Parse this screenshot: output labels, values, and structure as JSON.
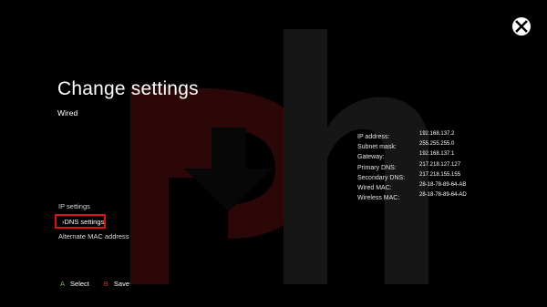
{
  "header": {
    "title": "Change settings",
    "subtitle": "Wired"
  },
  "menu": {
    "items": [
      {
        "label": "IP settings"
      },
      {
        "label": "DNS settings",
        "selected": true
      },
      {
        "label": "Alternate MAC address"
      }
    ],
    "selected_prefix": "›"
  },
  "network_info": {
    "rows": [
      {
        "label": "IP address:",
        "value": "192.168.137.2"
      },
      {
        "label": "Subnet mask:",
        "value": "255.255.255.0"
      },
      {
        "label": "Gateway:",
        "value": "192.168.137.1"
      },
      {
        "label": "Primary DNS:",
        "value": "217.218.127.127"
      },
      {
        "label": "Secondary DNS:",
        "value": "217.218.155.155"
      },
      {
        "label": "Wired MAC:",
        "value": "28-18-78-89-64-AB"
      },
      {
        "label": "Wireless MAC:",
        "value": "28-18-78-89-64-AD"
      }
    ]
  },
  "footer": {
    "select_key": "A",
    "select_label": "Select",
    "save_key": "B",
    "save_label": "Save"
  },
  "colors": {
    "background": "#000000",
    "highlight": "#e01010",
    "button_a": "#7ac142",
    "button_b": "#e03030",
    "watermark_red": "#2c0707",
    "watermark_gray": "#161616"
  },
  "icons": {
    "logo": "xbox-logo-icon"
  }
}
